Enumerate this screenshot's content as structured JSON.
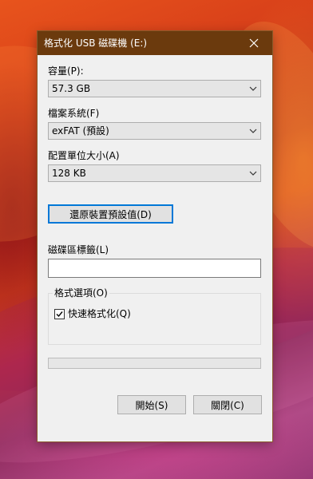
{
  "window": {
    "title": "格式化 USB 磁碟機 (E:)"
  },
  "capacity": {
    "label": "容量(P):",
    "value": "57.3 GB"
  },
  "file_system": {
    "label": "檔案系統(F)",
    "value": "exFAT (預設)"
  },
  "allocation_unit": {
    "label": "配置單位大小(A)",
    "value": "128 KB"
  },
  "restore_button": {
    "label": "還原裝置預設值(D)"
  },
  "volume_label": {
    "label": "磁碟區標籤(L)",
    "value": ""
  },
  "format_options": {
    "title": "格式選項(O)",
    "quick_format": {
      "label": "快速格式化(Q)",
      "checked": true
    }
  },
  "progress": {
    "value": 0
  },
  "buttons": {
    "start": "開始(S)",
    "close": "關閉(C)"
  },
  "colors": {
    "titlebar": "#6b3a0d",
    "accent": "#0078d7",
    "dialog_bg": "#f0f0f0"
  },
  "icons": {
    "close": "close-icon",
    "dropdown": "chevron-down-icon",
    "check": "checkmark-icon"
  }
}
